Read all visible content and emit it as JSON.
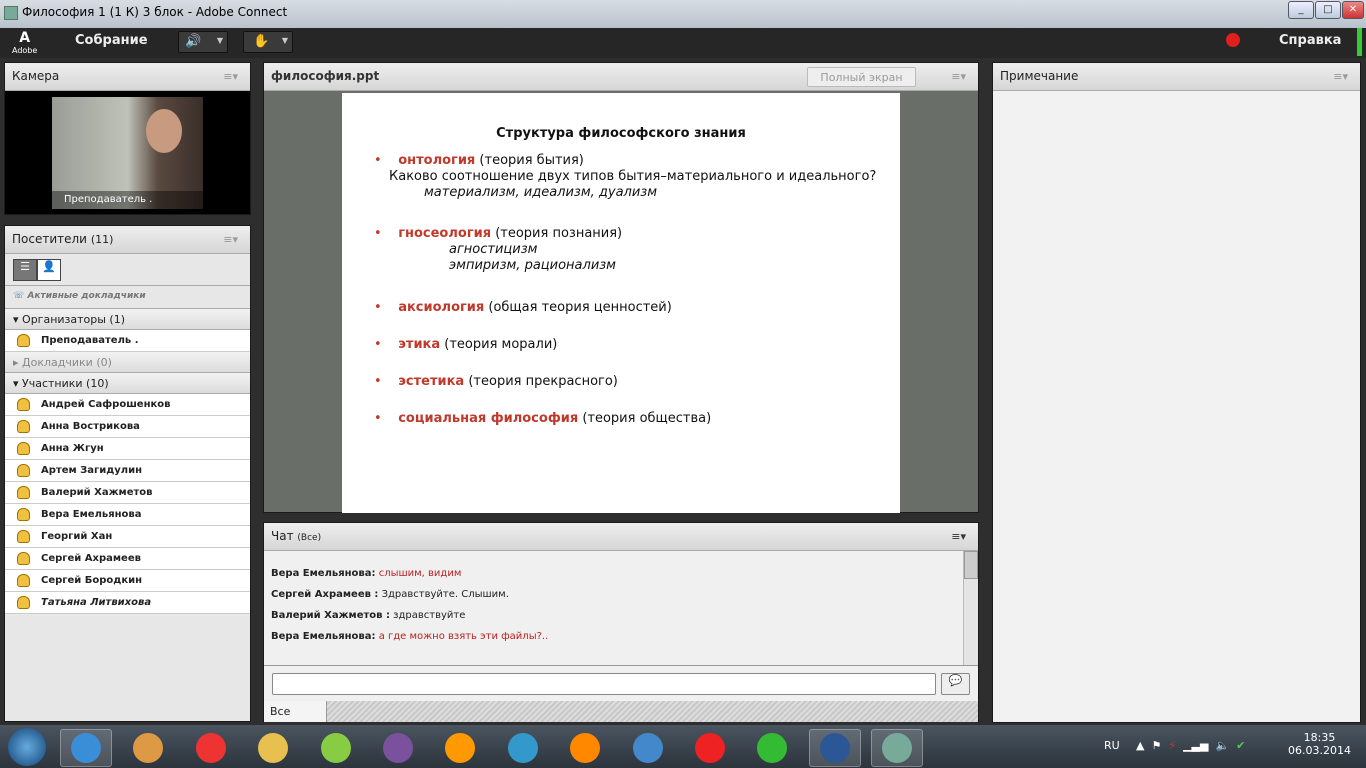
{
  "window": {
    "title": "Философия 1 (1 К) 3 блок - Adobe Connect"
  },
  "toolbar": {
    "logo": "Adobe",
    "meeting_menu": "Собрание",
    "help": "Справка"
  },
  "camera": {
    "title": "Камера",
    "label": "Преподаватель ."
  },
  "attendees": {
    "title": "Посетители",
    "count": "(11)",
    "active_speakers": "Активные докладчики",
    "hosts": {
      "label": "Организаторы (1)",
      "members": [
        "Преподаватель ."
      ]
    },
    "presenters": {
      "label": "Докладчики (0)"
    },
    "participants": {
      "label": "Участники (10)",
      "members": [
        "Андрей Сафрошенков",
        "Анна Вострикова",
        "Анна Жгун",
        "Артем Загидулин",
        "Валерий Хажметов",
        "Вера Емельянова",
        "Георгий Хан",
        "Сергей Ахрамеев",
        "Сергей Бородкин",
        "Татьяна Литвихова"
      ]
    }
  },
  "share": {
    "title": "философия.ppt",
    "fullscreen": "Полный экран"
  },
  "slide": {
    "heading": "Структура философского знания",
    "items": [
      {
        "term": "онтология",
        "desc": " (теория бытия)",
        "sub": [
          "Каково соотношение двух типов бытия–материального и идеального?",
          "материализм,  идеализм,  дуализм"
        ]
      },
      {
        "term": "гносеология",
        "desc": " (теория познания)",
        "sub": [
          "агностицизм",
          "эмпиризм,     рационализм"
        ]
      },
      {
        "term": "аксиология",
        "desc": " (общая теория ценностей)"
      },
      {
        "term": "этика",
        "desc": "  (теория морали)"
      },
      {
        "term": "эстетика",
        "desc": " (теория прекрасного)"
      },
      {
        "term": "социальная философия",
        "desc": " (теория общества)"
      }
    ]
  },
  "chat": {
    "title": "Чат",
    "scope": "(Все)",
    "tab": "Все",
    "messages": [
      {
        "from": "Вера Емельянова:",
        "text": " слышим, видим",
        "red": true
      },
      {
        "from": "Сергей Ахрамеев :",
        "text": " Здравствуйте. Слышим."
      },
      {
        "from": "Валерий Хажметов :",
        "text": " здравствуйте"
      },
      {
        "from": "Вера Емельянова:",
        "text": " а где можно взять эти файлы?..",
        "red": true
      }
    ],
    "input_value": ""
  },
  "notes": {
    "title": "Примечание"
  },
  "taskbar": {
    "lang": "RU",
    "time": "18:35",
    "date": "06.03.2014"
  }
}
